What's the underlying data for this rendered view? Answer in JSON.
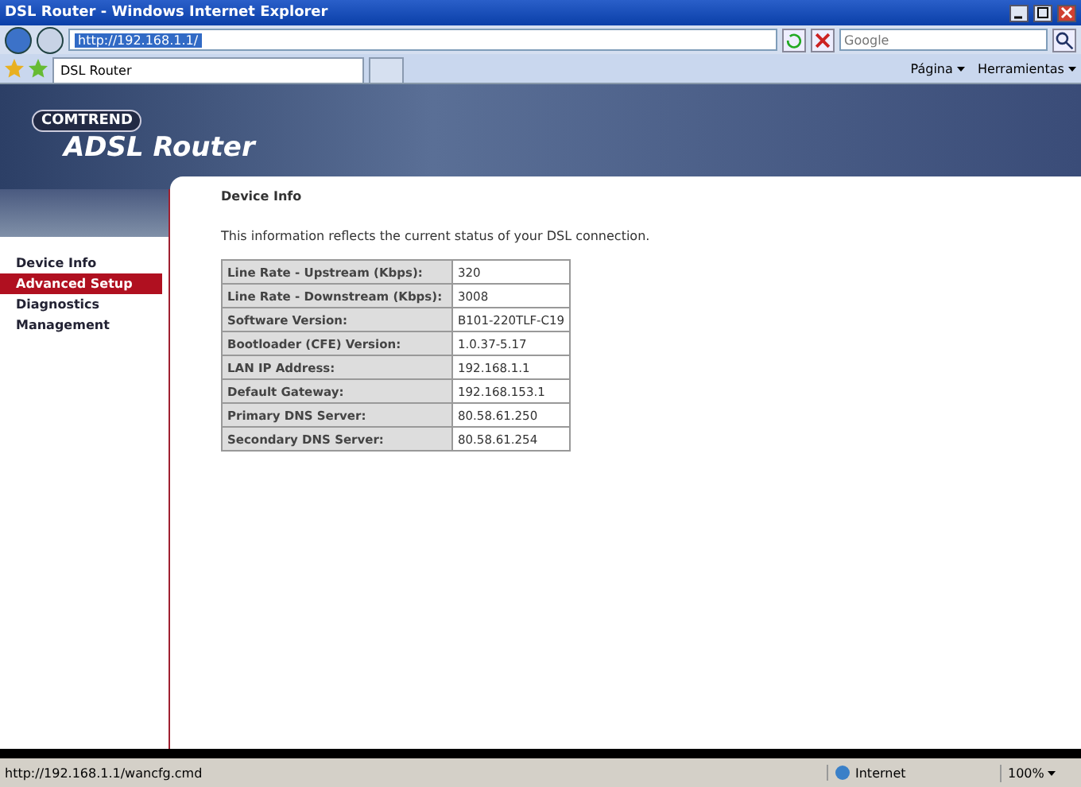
{
  "window": {
    "title": "DSL Router - Windows Internet Explorer"
  },
  "address_bar": {
    "url": "http://192.168.1.1/"
  },
  "search": {
    "placeholder": "Google"
  },
  "tabs": [
    {
      "label": "DSL Router",
      "selected": true
    }
  ],
  "command_bar": [
    "Página",
    "Herramientas"
  ],
  "banner": {
    "brand": "COMTREND",
    "product": "ADSL Router"
  },
  "sidebar": {
    "items": [
      {
        "label": "Device Info",
        "selected": false
      },
      {
        "label": "Advanced Setup",
        "selected": true
      },
      {
        "label": "Diagnostics",
        "selected": false
      },
      {
        "label": "Management",
        "selected": false
      }
    ]
  },
  "content": {
    "heading": "Device Info",
    "description": "This information reflects the current status of your DSL connection.",
    "rows": [
      {
        "label": "Line Rate - Upstream (Kbps):",
        "value": "320"
      },
      {
        "label": "Line Rate - Downstream (Kbps):",
        "value": "3008"
      },
      {
        "label": "Software Version:",
        "value": "B101-220TLF-C19"
      },
      {
        "label": "Bootloader (CFE) Version:",
        "value": "1.0.37-5.17"
      },
      {
        "label": "LAN IP Address:",
        "value": "192.168.1.1"
      },
      {
        "label": "Default Gateway:",
        "value": "192.168.153.1"
      },
      {
        "label": "Primary DNS Server:",
        "value": "80.58.61.250"
      },
      {
        "label": "Secondary DNS Server:",
        "value": "80.58.61.254"
      }
    ]
  },
  "status_bar": {
    "url": "http://192.168.1.1/wancfg.cmd",
    "zone": "Internet",
    "zoom": "100%"
  }
}
